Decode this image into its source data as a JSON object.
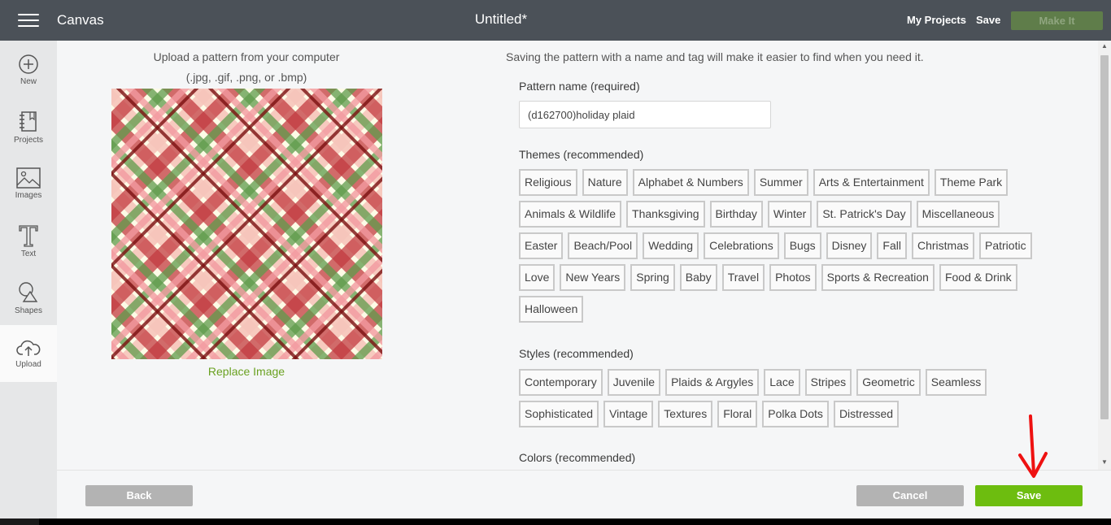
{
  "header": {
    "app_title": "Canvas",
    "doc_title": "Untitled*",
    "my_projects": "My Projects",
    "save": "Save",
    "make_it": "Make It"
  },
  "sidebar": {
    "items": [
      {
        "label": "New",
        "icon": "plus-circle-icon"
      },
      {
        "label": "Projects",
        "icon": "notebook-icon"
      },
      {
        "label": "Images",
        "icon": "image-icon"
      },
      {
        "label": "Text",
        "icon": "text-icon"
      },
      {
        "label": "Shapes",
        "icon": "shapes-icon"
      },
      {
        "label": "Upload",
        "icon": "cloud-upload-icon",
        "active": true
      }
    ]
  },
  "upload_panel": {
    "line1": "Upload a pattern from your computer",
    "line2": "(.jpg, .gif, .png, or .bmp)",
    "replace_image": "Replace Image"
  },
  "form": {
    "hint": "Saving the pattern with a name and tag will make it easier to find when you need it.",
    "name_label": "Pattern name (required)",
    "name_value": "(d162700)holiday plaid",
    "themes_label": "Themes (recommended)",
    "themes": [
      "Religious",
      "Nature",
      "Alphabet & Numbers",
      "Summer",
      "Arts & Entertainment",
      "Theme Park",
      "Animals & Wildlife",
      "Thanksgiving",
      "Birthday",
      "Winter",
      "St. Patrick's Day",
      "Miscellaneous",
      "Easter",
      "Beach/Pool",
      "Wedding",
      "Celebrations",
      "Bugs",
      "Disney",
      "Fall",
      "Christmas",
      "Patriotic",
      "Love",
      "New Years",
      "Spring",
      "Baby",
      "Travel",
      "Photos",
      "Sports & Recreation",
      "Food & Drink",
      "Halloween"
    ],
    "styles_label": "Styles (recommended)",
    "styles": [
      "Contemporary",
      "Juvenile",
      "Plaids & Argyles",
      "Lace",
      "Stripes",
      "Geometric",
      "Seamless",
      "Sophisticated",
      "Vintage",
      "Textures",
      "Floral",
      "Polka Dots",
      "Distressed"
    ],
    "colors_label": "Colors (recommended)"
  },
  "footer": {
    "back": "Back",
    "cancel": "Cancel",
    "save": "Save"
  },
  "colors": {
    "topbar": "#4b5158",
    "accent_green": "#6dbd0f",
    "link_green": "#6aa121",
    "annotation_red": "#ee1111"
  }
}
